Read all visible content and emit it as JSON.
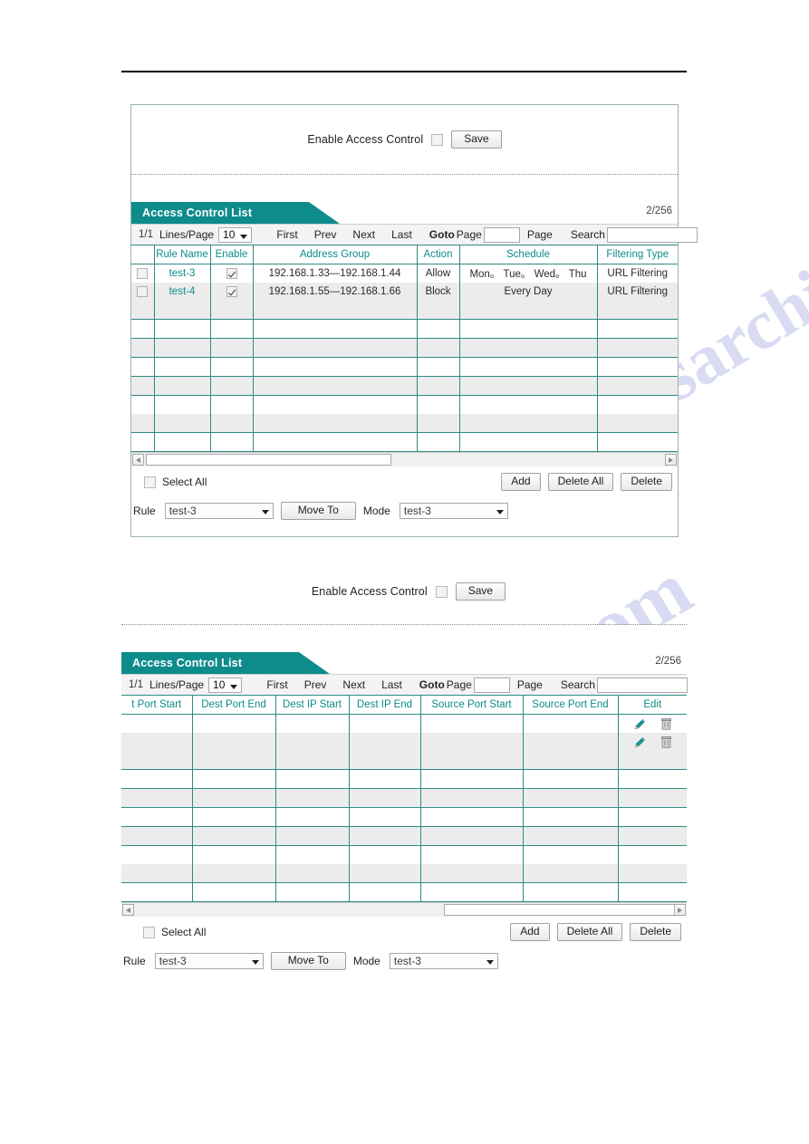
{
  "watermark": {
    "text1": "manualsarchive.com",
    "text2": "manualshare.com"
  },
  "panel1": {
    "enable": {
      "label": "Enable Access Control",
      "checked": false,
      "save_label": "Save"
    },
    "list": {
      "title": "Access Control List",
      "counter": "2/256",
      "toolbar": {
        "page_indicator": "1/1",
        "lines_per_page_label": "Lines/Page",
        "lines_per_page_value": "10",
        "first": "First",
        "prev": "Prev",
        "next": "Next",
        "last": "Last",
        "goto": "Goto",
        "page_label_before": "Page",
        "goto_page_value": "",
        "page_label_after": "Page",
        "search_label": "Search",
        "search_value": ""
      },
      "columns": [
        "",
        "Rule Name",
        "Enable",
        "Address Group",
        "Action",
        "Schedule",
        "Filtering Type"
      ],
      "rows": [
        {
          "select": false,
          "rule_name": "test-3",
          "enable": true,
          "address_group": "192.168.1.33—192.168.1.44",
          "action": "Allow",
          "schedule": "Mon。 Tue。 Wed。 Thu",
          "filtering_type": "URL Filtering"
        },
        {
          "select": false,
          "rule_name": "test-4",
          "enable": true,
          "address_group": "192.168.1.55—192.168.1.66",
          "action": "Block",
          "schedule": "Every Day",
          "filtering_type": "URL Filtering"
        }
      ],
      "blank_row_count": 7
    },
    "actions": {
      "select_all_label": "Select All",
      "select_all_checked": false,
      "add": "Add",
      "delete_all": "Delete All",
      "delete": "Delete"
    },
    "rule_bar": {
      "rule_label": "Rule",
      "rule_value": "test-3",
      "move_to": "Move To",
      "mode_label": "Mode",
      "mode_value": "test-3"
    },
    "scroll": {
      "thumb_left_pct": 0,
      "thumb_width_pct": 45
    }
  },
  "panel2": {
    "enable": {
      "label": "Enable Access Control",
      "checked": false,
      "save_label": "Save"
    },
    "list": {
      "title": "Access Control List",
      "counter": "2/256",
      "toolbar": {
        "page_indicator": "1/1",
        "lines_per_page_label": "Lines/Page",
        "lines_per_page_value": "10",
        "first": "First",
        "prev": "Prev",
        "next": "Next",
        "last": "Last",
        "goto": "Goto",
        "page_label_before": "Page",
        "goto_page_value": "",
        "page_label_after": "Page",
        "search_label": "Search",
        "search_value": ""
      },
      "columns": [
        "t Port Start",
        "Dest Port End",
        "Dest IP Start",
        "Dest IP End",
        "Source Port Start",
        "Source Port End",
        "Edit"
      ],
      "rows": [
        {
          "dest_port_start": "",
          "dest_port_end": "",
          "dest_ip_start": "",
          "dest_ip_end": "",
          "source_port_start": "",
          "source_port_end": "",
          "edit_icons": [
            "pencil-icon",
            "trash-icon"
          ]
        },
        {
          "dest_port_start": "",
          "dest_port_end": "",
          "dest_ip_start": "",
          "dest_ip_end": "",
          "source_port_start": "",
          "source_port_end": "",
          "edit_icons": [
            "pencil-icon",
            "trash-icon"
          ]
        }
      ],
      "blank_row_count": 7
    },
    "actions": {
      "select_all_label": "Select All",
      "select_all_checked": false,
      "add": "Add",
      "delete_all": "Delete All",
      "delete": "Delete"
    },
    "rule_bar": {
      "rule_label": "Rule",
      "rule_value": "test-3",
      "move_to": "Move To",
      "mode_label": "Mode",
      "mode_value": "test-3"
    },
    "scroll": {
      "thumb_left_pct": 57,
      "thumb_width_pct": 41
    }
  },
  "colors": {
    "teal": "#0e8b8b",
    "grid_line": "#2e8b84",
    "row_alt": "#ececec",
    "toolbar_bg": "#f3f3f3"
  }
}
